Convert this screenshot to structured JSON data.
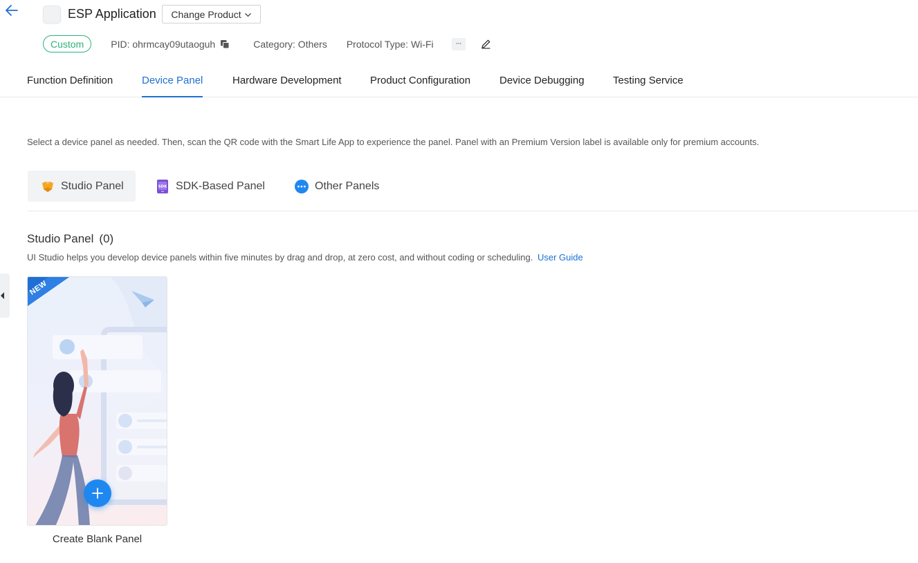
{
  "header": {
    "product_name": "ESP Application",
    "change_product_label": "Change Product",
    "badge": "Custom",
    "pid": "PID: ohrmcay09utaoguh",
    "category": "Category: Others",
    "protocol": "Protocol Type: Wi-Fi",
    "more_label": "···"
  },
  "tabs": [
    {
      "label": "Function Definition",
      "active": false
    },
    {
      "label": "Device Panel",
      "active": true
    },
    {
      "label": "Hardware Development",
      "active": false
    },
    {
      "label": "Product Configuration",
      "active": false
    },
    {
      "label": "Device Debugging",
      "active": false
    },
    {
      "label": "Testing Service",
      "active": false
    }
  ],
  "description": "Select a device panel as needed. Then, scan the QR code with the Smart Life App to experience the panel. Panel with an Premium Version label is available only for premium accounts.",
  "subtabs": [
    {
      "label": "Studio Panel",
      "icon": "studio-panel-icon",
      "active": true
    },
    {
      "label": "SDK-Based Panel",
      "icon": "sdk-icon",
      "active": false
    },
    {
      "label": "Other Panels",
      "icon": "more-dots-icon",
      "active": false
    }
  ],
  "section": {
    "title": "Studio Panel",
    "count": "(0)",
    "description": "UI Studio helps you develop device panels within five minutes by drag and drop, at zero cost, and without coding or scheduling.",
    "link": "User Guide"
  },
  "card": {
    "ribbon": "NEW",
    "label": "Create Blank Panel"
  },
  "colors": {
    "accent": "#1d6fd1",
    "badge_green": "#2bb37a",
    "plus_blue": "#1f88f0"
  }
}
